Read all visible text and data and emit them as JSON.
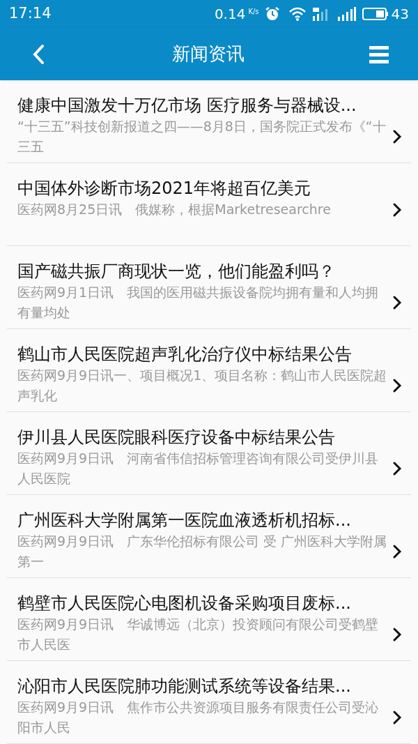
{
  "status_bar": {
    "time": "17:14",
    "speed": "0.14",
    "speed_unit": "K/s",
    "battery": "43"
  },
  "header": {
    "title": "新闻资讯"
  },
  "news": [
    {
      "title": "健康中国激发十万亿市场 医疗服务与器械设...",
      "summary": "“十三五”科技创新报道之四——8月8日，国务院正式发布《“十三五"
    },
    {
      "title": "中国体外诊断市场2021年将超百亿美元",
      "summary": "医药网8月25日讯　俄媒称，根据Marketresearchre"
    },
    {
      "title": "国产磁共振厂商现状一览，他们能盈利吗？",
      "summary": "医药网9月1日讯　我国的医用磁共振设备院均拥有量和人均拥有量均处"
    },
    {
      "title": "鹤山市人民医院超声乳化治疗仪中标结果公告",
      "summary": "医药网9月9日讯一、项目概况1、项目名称：鹤山市人民医院超声乳化"
    },
    {
      "title": "伊川县人民医院眼科医疗设备中标结果公告",
      "summary": "医药网9月9日讯　河南省伟信招标管理咨询有限公司受伊川县人民医院"
    },
    {
      "title": "广州医科大学附属第一医院血液透析机招标...",
      "summary": "医药网9月9日讯　广东华伦招标有限公司 受 广州医科大学附属第一"
    },
    {
      "title": "鹤壁市人民医院心电图机设备采购项目废标...",
      "summary": "医药网9月9日讯　华诚博远（北京）投资顾问有限公司受鹤壁市人民医"
    },
    {
      "title": "沁阳市人民医院肺功能测试系统等设备结果...",
      "summary": "医药网9月9日讯　焦作市公共资源项目服务有限责任公司受沁阳市人民"
    }
  ]
}
